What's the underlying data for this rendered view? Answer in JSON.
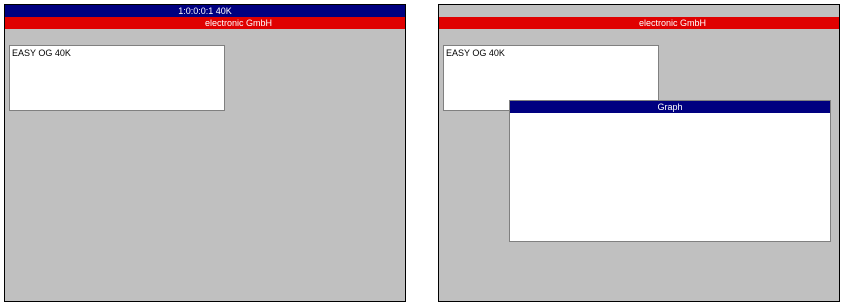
{
  "left": {
    "title": "1:0:0:0:1 40K",
    "device": "EASY OG 40K",
    "brand": "electronic GmbH"
  },
  "right": {
    "device": "EASY OG 40K",
    "brand": "electronic GmbH",
    "graph_title": "Graph"
  }
}
